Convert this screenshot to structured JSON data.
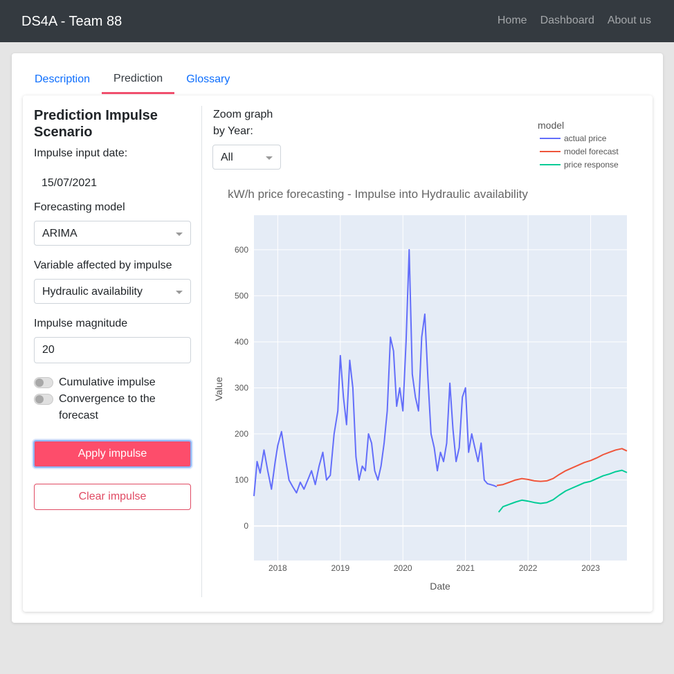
{
  "navbar": {
    "brand": "DS4A - Team 88",
    "links": [
      "Home",
      "Dashboard",
      "About us"
    ]
  },
  "tabs": [
    {
      "label": "Description",
      "active": false
    },
    {
      "label": "Prediction",
      "active": true
    },
    {
      "label": "Glossary",
      "active": false
    }
  ],
  "sidebar": {
    "title": "Prediction Impulse Scenario",
    "date_label": "Impulse input date:",
    "date_value": "15/07/2021",
    "model_label": "Forecasting model",
    "model_value": "ARIMA",
    "variable_label": "Variable affected by impulse",
    "variable_value": "Hydraulic availability",
    "magnitude_label": "Impulse magnitude",
    "magnitude_value": "20",
    "toggle_cumulative": "Cumulative impulse",
    "toggle_convergence": "Convergence to the forecast",
    "apply_label": "Apply impulse",
    "clear_label": "Clear impulse"
  },
  "zoom": {
    "label": "Zoom graph by Year:",
    "value": "All"
  },
  "colors": {
    "actual": "#636efa",
    "forecast": "#ef553b",
    "response": "#00cc96",
    "accent": "#fd4d6b",
    "plot_bg": "#e5ecf6"
  },
  "chart_data": {
    "type": "line",
    "title": "kW/h price forecasting - Impulse into Hydraulic availability",
    "xlabel": "Date",
    "ylabel": "Value",
    "legend_title": "model",
    "legend_position": "top-right",
    "grid": true,
    "xlim": [
      2017.62,
      2023.58
    ],
    "ylim": [
      -75,
      675
    ],
    "xticks": [
      2018,
      2019,
      2020,
      2021,
      2022,
      2023
    ],
    "yticks": [
      0,
      100,
      200,
      300,
      400,
      500,
      600
    ],
    "series": [
      {
        "name": "actual price",
        "x": [
          2017.62,
          2017.67,
          2017.72,
          2017.78,
          2017.84,
          2017.9,
          2017.96,
          2018.0,
          2018.06,
          2018.12,
          2018.18,
          2018.24,
          2018.3,
          2018.36,
          2018.42,
          2018.48,
          2018.54,
          2018.6,
          2018.66,
          2018.72,
          2018.78,
          2018.84,
          2018.9,
          2018.96,
          2019.0,
          2019.05,
          2019.1,
          2019.15,
          2019.2,
          2019.25,
          2019.3,
          2019.35,
          2019.4,
          2019.45,
          2019.5,
          2019.55,
          2019.6,
          2019.65,
          2019.7,
          2019.75,
          2019.8,
          2019.85,
          2019.9,
          2019.95,
          2020.0,
          2020.05,
          2020.1,
          2020.15,
          2020.2,
          2020.25,
          2020.3,
          2020.35,
          2020.4,
          2020.45,
          2020.5,
          2020.55,
          2020.6,
          2020.65,
          2020.7,
          2020.75,
          2020.8,
          2020.85,
          2020.9,
          2020.95,
          2021.0,
          2021.05,
          2021.1,
          2021.15,
          2021.2,
          2021.25,
          2021.3,
          2021.35,
          2021.4,
          2021.45,
          2021.5
        ],
        "y": [
          65,
          140,
          115,
          165,
          120,
          80,
          140,
          175,
          205,
          150,
          100,
          85,
          72,
          95,
          80,
          100,
          120,
          90,
          130,
          160,
          100,
          110,
          200,
          250,
          370,
          280,
          220,
          360,
          300,
          150,
          100,
          130,
          120,
          200,
          180,
          120,
          100,
          130,
          180,
          250,
          410,
          380,
          260,
          300,
          250,
          400,
          600,
          330,
          280,
          250,
          410,
          460,
          320,
          200,
          170,
          120,
          160,
          140,
          180,
          310,
          210,
          140,
          170,
          280,
          300,
          160,
          200,
          170,
          140,
          180,
          100,
          92,
          90,
          88,
          85
        ],
        "color": "#636efa"
      },
      {
        "name": "model forecast",
        "x": [
          2021.5,
          2021.6,
          2021.7,
          2021.8,
          2021.9,
          2022.0,
          2022.1,
          2022.2,
          2022.3,
          2022.4,
          2022.5,
          2022.6,
          2022.7,
          2022.8,
          2022.9,
          2023.0,
          2023.1,
          2023.2,
          2023.3,
          2023.4,
          2023.5,
          2023.58
        ],
        "y": [
          88,
          90,
          95,
          100,
          103,
          101,
          98,
          97,
          98,
          103,
          112,
          120,
          126,
          132,
          138,
          142,
          148,
          155,
          160,
          165,
          168,
          163
        ],
        "color": "#ef553b"
      },
      {
        "name": "price response",
        "x": [
          2021.53,
          2021.6,
          2021.7,
          2021.8,
          2021.9,
          2022.0,
          2022.1,
          2022.2,
          2022.3,
          2022.4,
          2022.5,
          2022.6,
          2022.7,
          2022.8,
          2022.9,
          2023.0,
          2023.1,
          2023.2,
          2023.3,
          2023.4,
          2023.5,
          2023.58
        ],
        "y": [
          30,
          42,
          47,
          52,
          56,
          54,
          51,
          49,
          51,
          57,
          67,
          76,
          82,
          88,
          94,
          97,
          103,
          109,
          113,
          118,
          121,
          116
        ],
        "color": "#00cc96"
      }
    ]
  }
}
